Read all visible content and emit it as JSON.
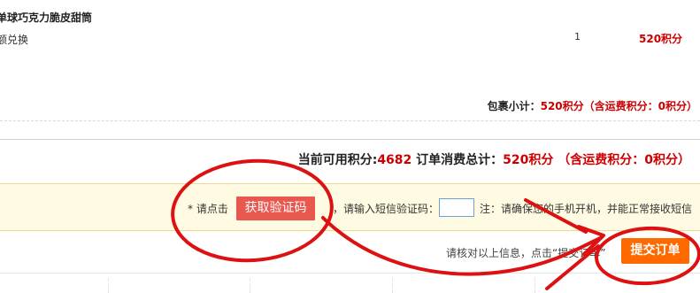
{
  "order_item": {
    "product_name": "单球巧克力脆皮甜筒",
    "redeem_type": "额兑换",
    "quantity": "1",
    "points": "520积分"
  },
  "package": {
    "subtotal_label": "包裹小计：",
    "subtotal_value": "520积分（含运费积分：0积分）"
  },
  "summary": {
    "available_label": "当前可用积分:",
    "available_points": "4682",
    "total_label": "订单消费总计：",
    "total_value": "520积分 （含运费积分：0积分）"
  },
  "verification": {
    "prompt": "* 请点击",
    "get_code_button": "获取验证码",
    "code_label": "，请输入短信验证码：",
    "code_input_value": "",
    "note": "注：请确保您的手机开机，并能正常接收短信"
  },
  "footer": {
    "confirm_text": "请核对以上信息，点击“提交订单”",
    "submit_button": "提交订单"
  },
  "colors": {
    "points_red": "#cc0000",
    "verify_button": "#e8584e",
    "submit_button": "#ff6a00",
    "annotation_red": "#dd1111",
    "verify_bar_bg": "#fffbe3"
  }
}
